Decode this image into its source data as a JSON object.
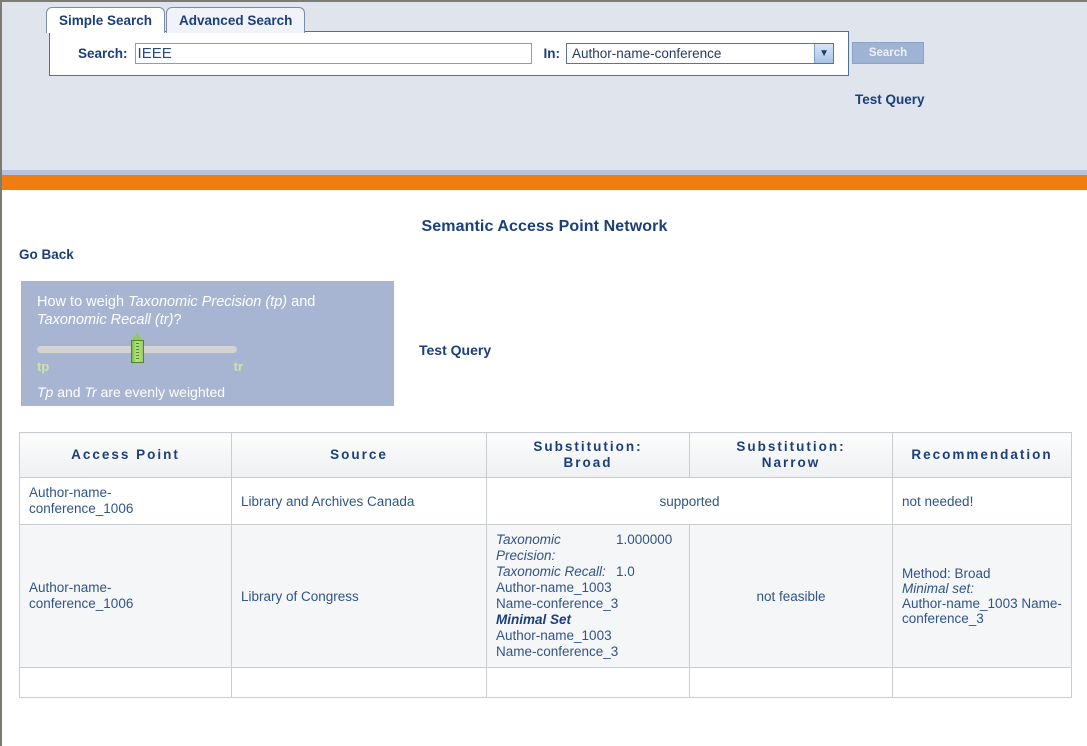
{
  "header": {
    "tabs": [
      {
        "label": "Simple Search",
        "active": true
      },
      {
        "label": "Advanced Search",
        "active": false
      }
    ],
    "search_label": "Search:",
    "search_value": "IEEE",
    "search_placeholder": "",
    "in_label": "In:",
    "in_selected": "Author-name-conference",
    "in_options": [
      "Author-name-conference"
    ],
    "search_button": "Search",
    "test_query_link": "Test Query"
  },
  "main": {
    "title": "Semantic Access Point Network",
    "go_back": "Go Back",
    "test_query_link": "Test Query"
  },
  "weight_panel": {
    "question_pre": "How to weigh ",
    "question_em1": "Taxonomic Precision (tp)",
    "question_mid": " and ",
    "question_em2": "Taxonomic Recall (tr)",
    "question_post": "?",
    "slider_left_label": "tp",
    "slider_right_label": "tr",
    "slider_position_percent": 50,
    "note_em1": "Tp",
    "note_mid": " and ",
    "note_em2": "Tr",
    "note_post": " are evenly weighted"
  },
  "table": {
    "headers": [
      "Access Point",
      "Source",
      "Substitution: Broad",
      "Substitution: Narrow",
      "Recommendation"
    ],
    "headers_lines": {
      "h3_line1": "Substitution:",
      "h3_line2": "Broad",
      "h4_line1": "Substitution:",
      "h4_line2": "Narrow"
    },
    "rows": [
      {
        "access_point": "Author-name-conference_1006",
        "access_point_line1": "Author-name-",
        "access_point_line2": "conference_1006",
        "source": "Library and Archives Canada",
        "substitution_span": "supported",
        "recommendation": "not needed!"
      },
      {
        "access_point_line1": "Author-name-",
        "access_point_line2": "conference_1006",
        "source": "Library of Congress",
        "broad": {
          "tp_label": "Taxonomic Precision:",
          "tp_value": "1.000000",
          "tr_label": "Taxonomic Recall:",
          "tr_value": "1.0",
          "terms": [
            "Author-name_1003",
            "Name-conference_3"
          ],
          "minimal_set_label": "Minimal Set",
          "minimal_set_terms": [
            "Author-name_1003",
            "Name-conference_3"
          ]
        },
        "narrow": "not feasible",
        "recommendation": {
          "method": "Method: Broad",
          "minimal_set_label": "Minimal set:",
          "terms": [
            "Author-name_1003",
            "Name-conference_3"
          ]
        }
      }
    ]
  },
  "colors": {
    "header_bg": "#e0e4ed",
    "accent_orange": "#f07d11",
    "link_blue": "#1a3f7a",
    "panel_blue": "#a7b5d2",
    "slider_green": "#8fca5e"
  }
}
